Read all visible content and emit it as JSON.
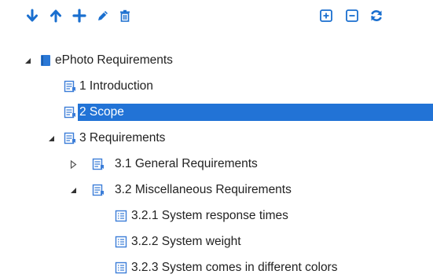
{
  "colors": {
    "accent": "#1a6fcf",
    "selection": "#2273d6",
    "doc_icon": "#3b7dd8",
    "text": "#222222"
  },
  "toolbar": {
    "buttons": [
      {
        "icon": "arrow-down-icon",
        "action": "move-down"
      },
      {
        "icon": "arrow-up-icon",
        "action": "move-up"
      },
      {
        "icon": "plus-icon",
        "action": "add"
      },
      {
        "icon": "pencil-icon",
        "action": "edit"
      },
      {
        "icon": "trash-icon",
        "action": "delete"
      },
      {
        "icon": "expand-all-icon",
        "action": "expand-all"
      },
      {
        "icon": "collapse-all-icon",
        "action": "collapse-all"
      },
      {
        "icon": "refresh-icon",
        "action": "refresh"
      }
    ]
  },
  "tree": {
    "root": {
      "label": "ePhoto Requirements",
      "icon": "book-icon",
      "expanded": true
    },
    "introduction": {
      "label": "1 Introduction",
      "icon": "chapter-doc-icon"
    },
    "scope": {
      "label": "2 Scope",
      "icon": "chapter-doc-icon",
      "selected": true
    },
    "requirements": {
      "label": "3 Requirements",
      "icon": "chapter-doc-icon",
      "expanded": true
    },
    "general": {
      "label": "3.1 General Requirements",
      "icon": "chapter-doc-icon",
      "expanded": false
    },
    "misc": {
      "label": "3.2 Miscellaneous Requirements",
      "icon": "chapter-doc-icon",
      "expanded": true
    },
    "response_times": {
      "label": "3.2.1 System response times",
      "icon": "requirement-list-icon"
    },
    "weight": {
      "label": "3.2.2 System weight",
      "icon": "requirement-list-icon"
    },
    "colors": {
      "label": "3.2.3 System comes in different colors",
      "icon": "requirement-list-icon"
    }
  }
}
